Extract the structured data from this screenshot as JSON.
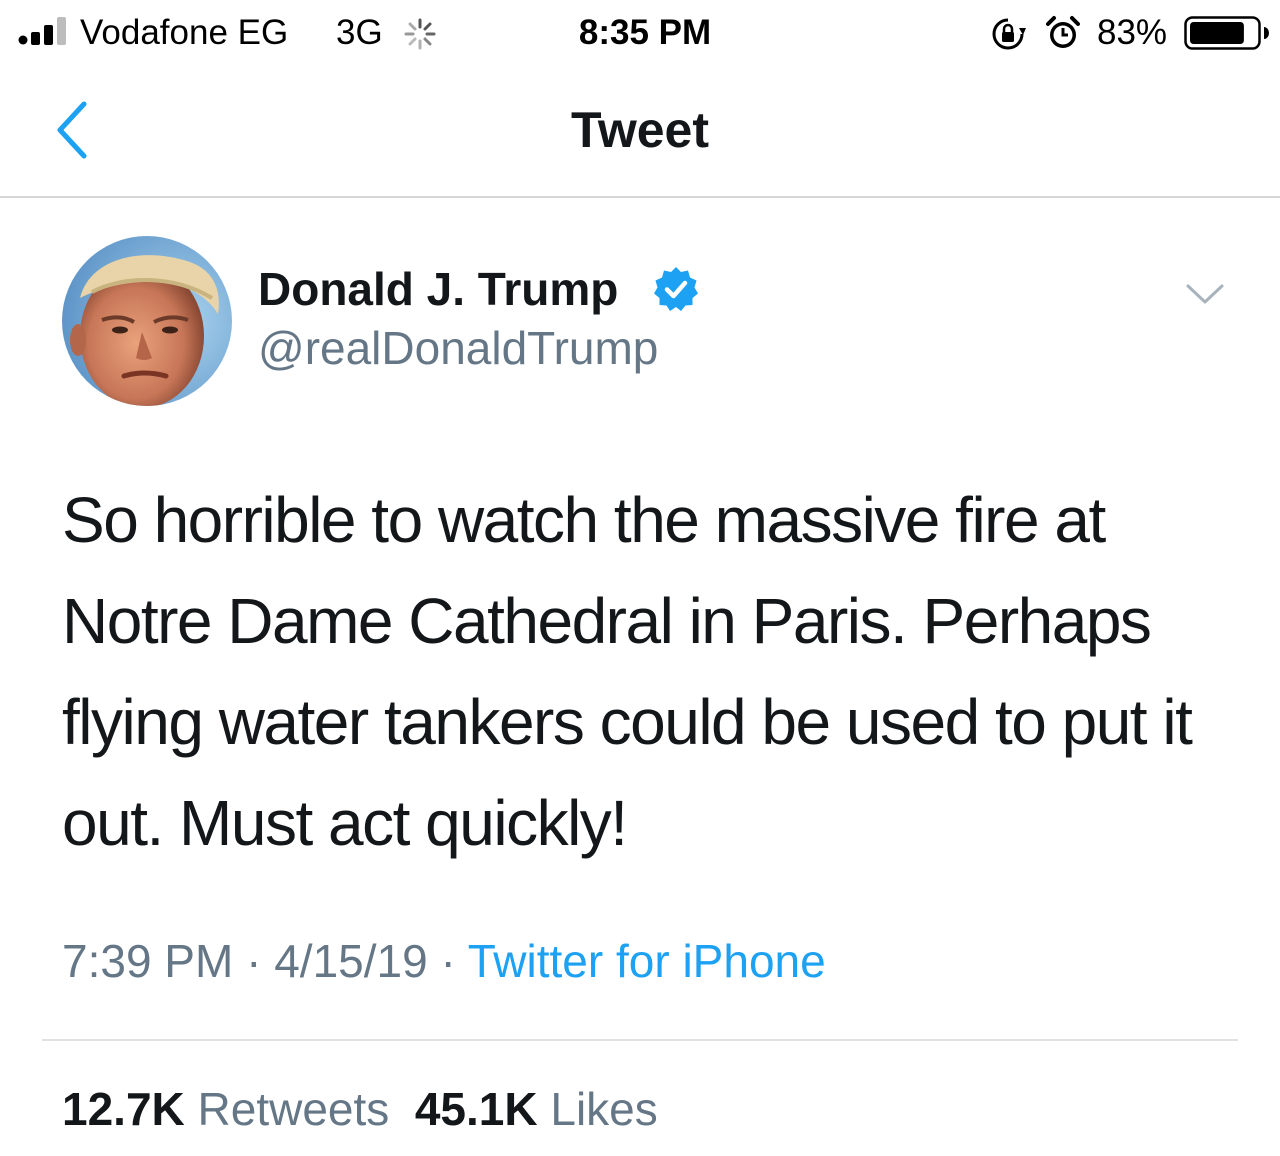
{
  "status_bar": {
    "carrier": "Vodafone EG",
    "network": "3G",
    "time": "8:35 PM",
    "battery_percent": "83%",
    "battery_level": 0.83,
    "signal_bars": 3,
    "icons": [
      "signal-icon",
      "activity-spinner-icon",
      "rotation-lock-icon",
      "alarm-icon",
      "battery-icon"
    ]
  },
  "nav": {
    "title": "Tweet",
    "back_icon": "chevron-left-icon",
    "accent_color": "#1da1f2"
  },
  "tweet": {
    "author_name": "Donald J. Trump",
    "handle": "@realDonaldTrump",
    "verified": true,
    "text": "So horrible to watch the massive fire at Notre Dame Cathedral in Paris. Perhaps flying water tankers could be used to put it out. Must act quickly!",
    "time": "7:39 PM",
    "separator": "·",
    "date": "4/15/19",
    "source": "Twitter for iPhone",
    "retweets_count": "12.7K",
    "retweets_label": "Retweets",
    "likes_count": "45.1K",
    "likes_label": "Likes"
  },
  "colors": {
    "text_primary": "#14171a",
    "text_secondary": "#657786",
    "link_blue": "#1da1f2",
    "verified_blue": "#1da1f2"
  }
}
